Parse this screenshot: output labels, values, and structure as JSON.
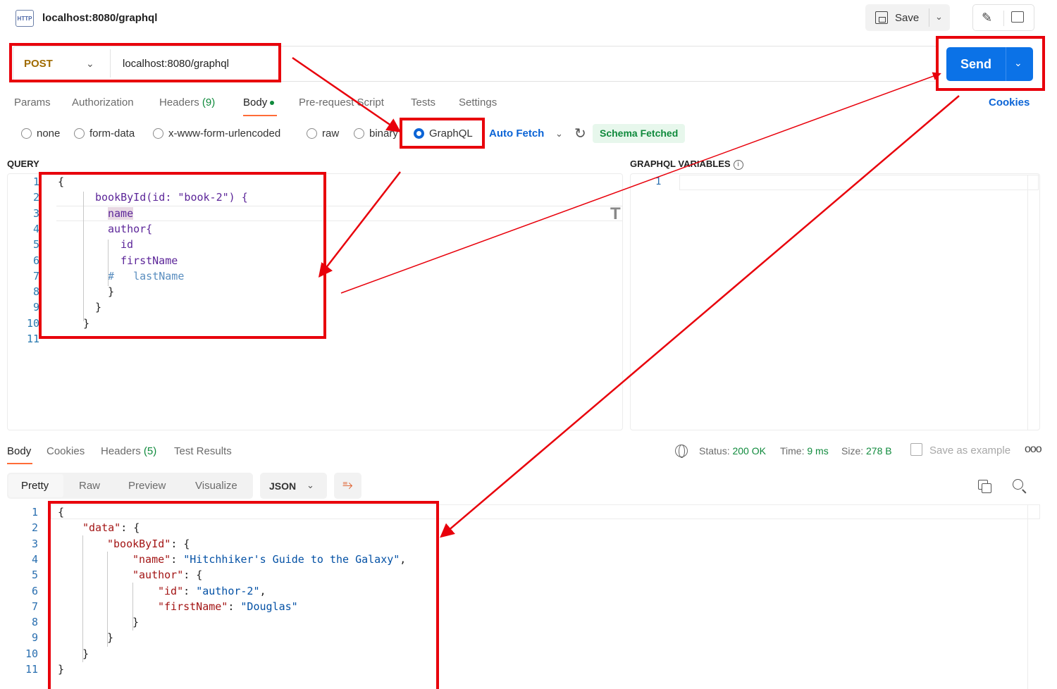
{
  "header": {
    "http_badge": "HTTP",
    "title": "localhost:8080/graphql",
    "save_label": "Save"
  },
  "request": {
    "method": "POST",
    "url": "localhost:8080/graphql",
    "send_label": "Send"
  },
  "tabs": {
    "params": "Params",
    "authorization": "Authorization",
    "headers": "Headers",
    "headers_count": "(9)",
    "body": "Body",
    "prerequest": "Pre-request Script",
    "tests": "Tests",
    "settings": "Settings",
    "cookies": "Cookies"
  },
  "body_options": {
    "none": "none",
    "form_data": "form-data",
    "urlencoded": "x-www-form-urlencoded",
    "raw": "raw",
    "binary": "binary",
    "graphql": "GraphQL",
    "selected": "GraphQL",
    "auto_fetch": "Auto Fetch",
    "schema_status": "Schema Fetched"
  },
  "query": {
    "label": "QUERY",
    "lines": [
      "{",
      "  bookById(id: \"book-2\") {",
      "    name",
      "    author{",
      "      id",
      "      firstName",
      "#   lastName",
      "    }",
      "  }",
      "}",
      ""
    ]
  },
  "variables": {
    "label": "GRAPHQL VARIABLES",
    "info": "i",
    "line_number": "1"
  },
  "response": {
    "tabs": {
      "body": "Body",
      "cookies": "Cookies",
      "headers": "Headers",
      "headers_count": "(5)",
      "test_results": "Test Results"
    },
    "status_label": "Status:",
    "status_value": "200 OK",
    "time_label": "Time:",
    "time_value": "9 ms",
    "size_label": "Size:",
    "size_value": "278 B",
    "save_example": "Save as example",
    "more": "ooo",
    "views": {
      "pretty": "Pretty",
      "raw": "Raw",
      "preview": "Preview",
      "visualize": "Visualize"
    },
    "format": "JSON",
    "json": {
      "data_key": "\"data\"",
      "bookById_key": "\"bookById\"",
      "name_key": "\"name\"",
      "name_value": "\"Hitchhiker's Guide to the Galaxy\"",
      "author_key": "\"author\"",
      "id_key": "\"id\"",
      "id_value": "\"author-2\"",
      "firstName_key": "\"firstName\"",
      "firstName_value": "\"Douglas\""
    }
  },
  "colors": {
    "send": "#0b72e7",
    "accent": "#ff6c37",
    "annotation": "#e8000b",
    "method": "#a06b00",
    "success": "#0f8a3c"
  }
}
